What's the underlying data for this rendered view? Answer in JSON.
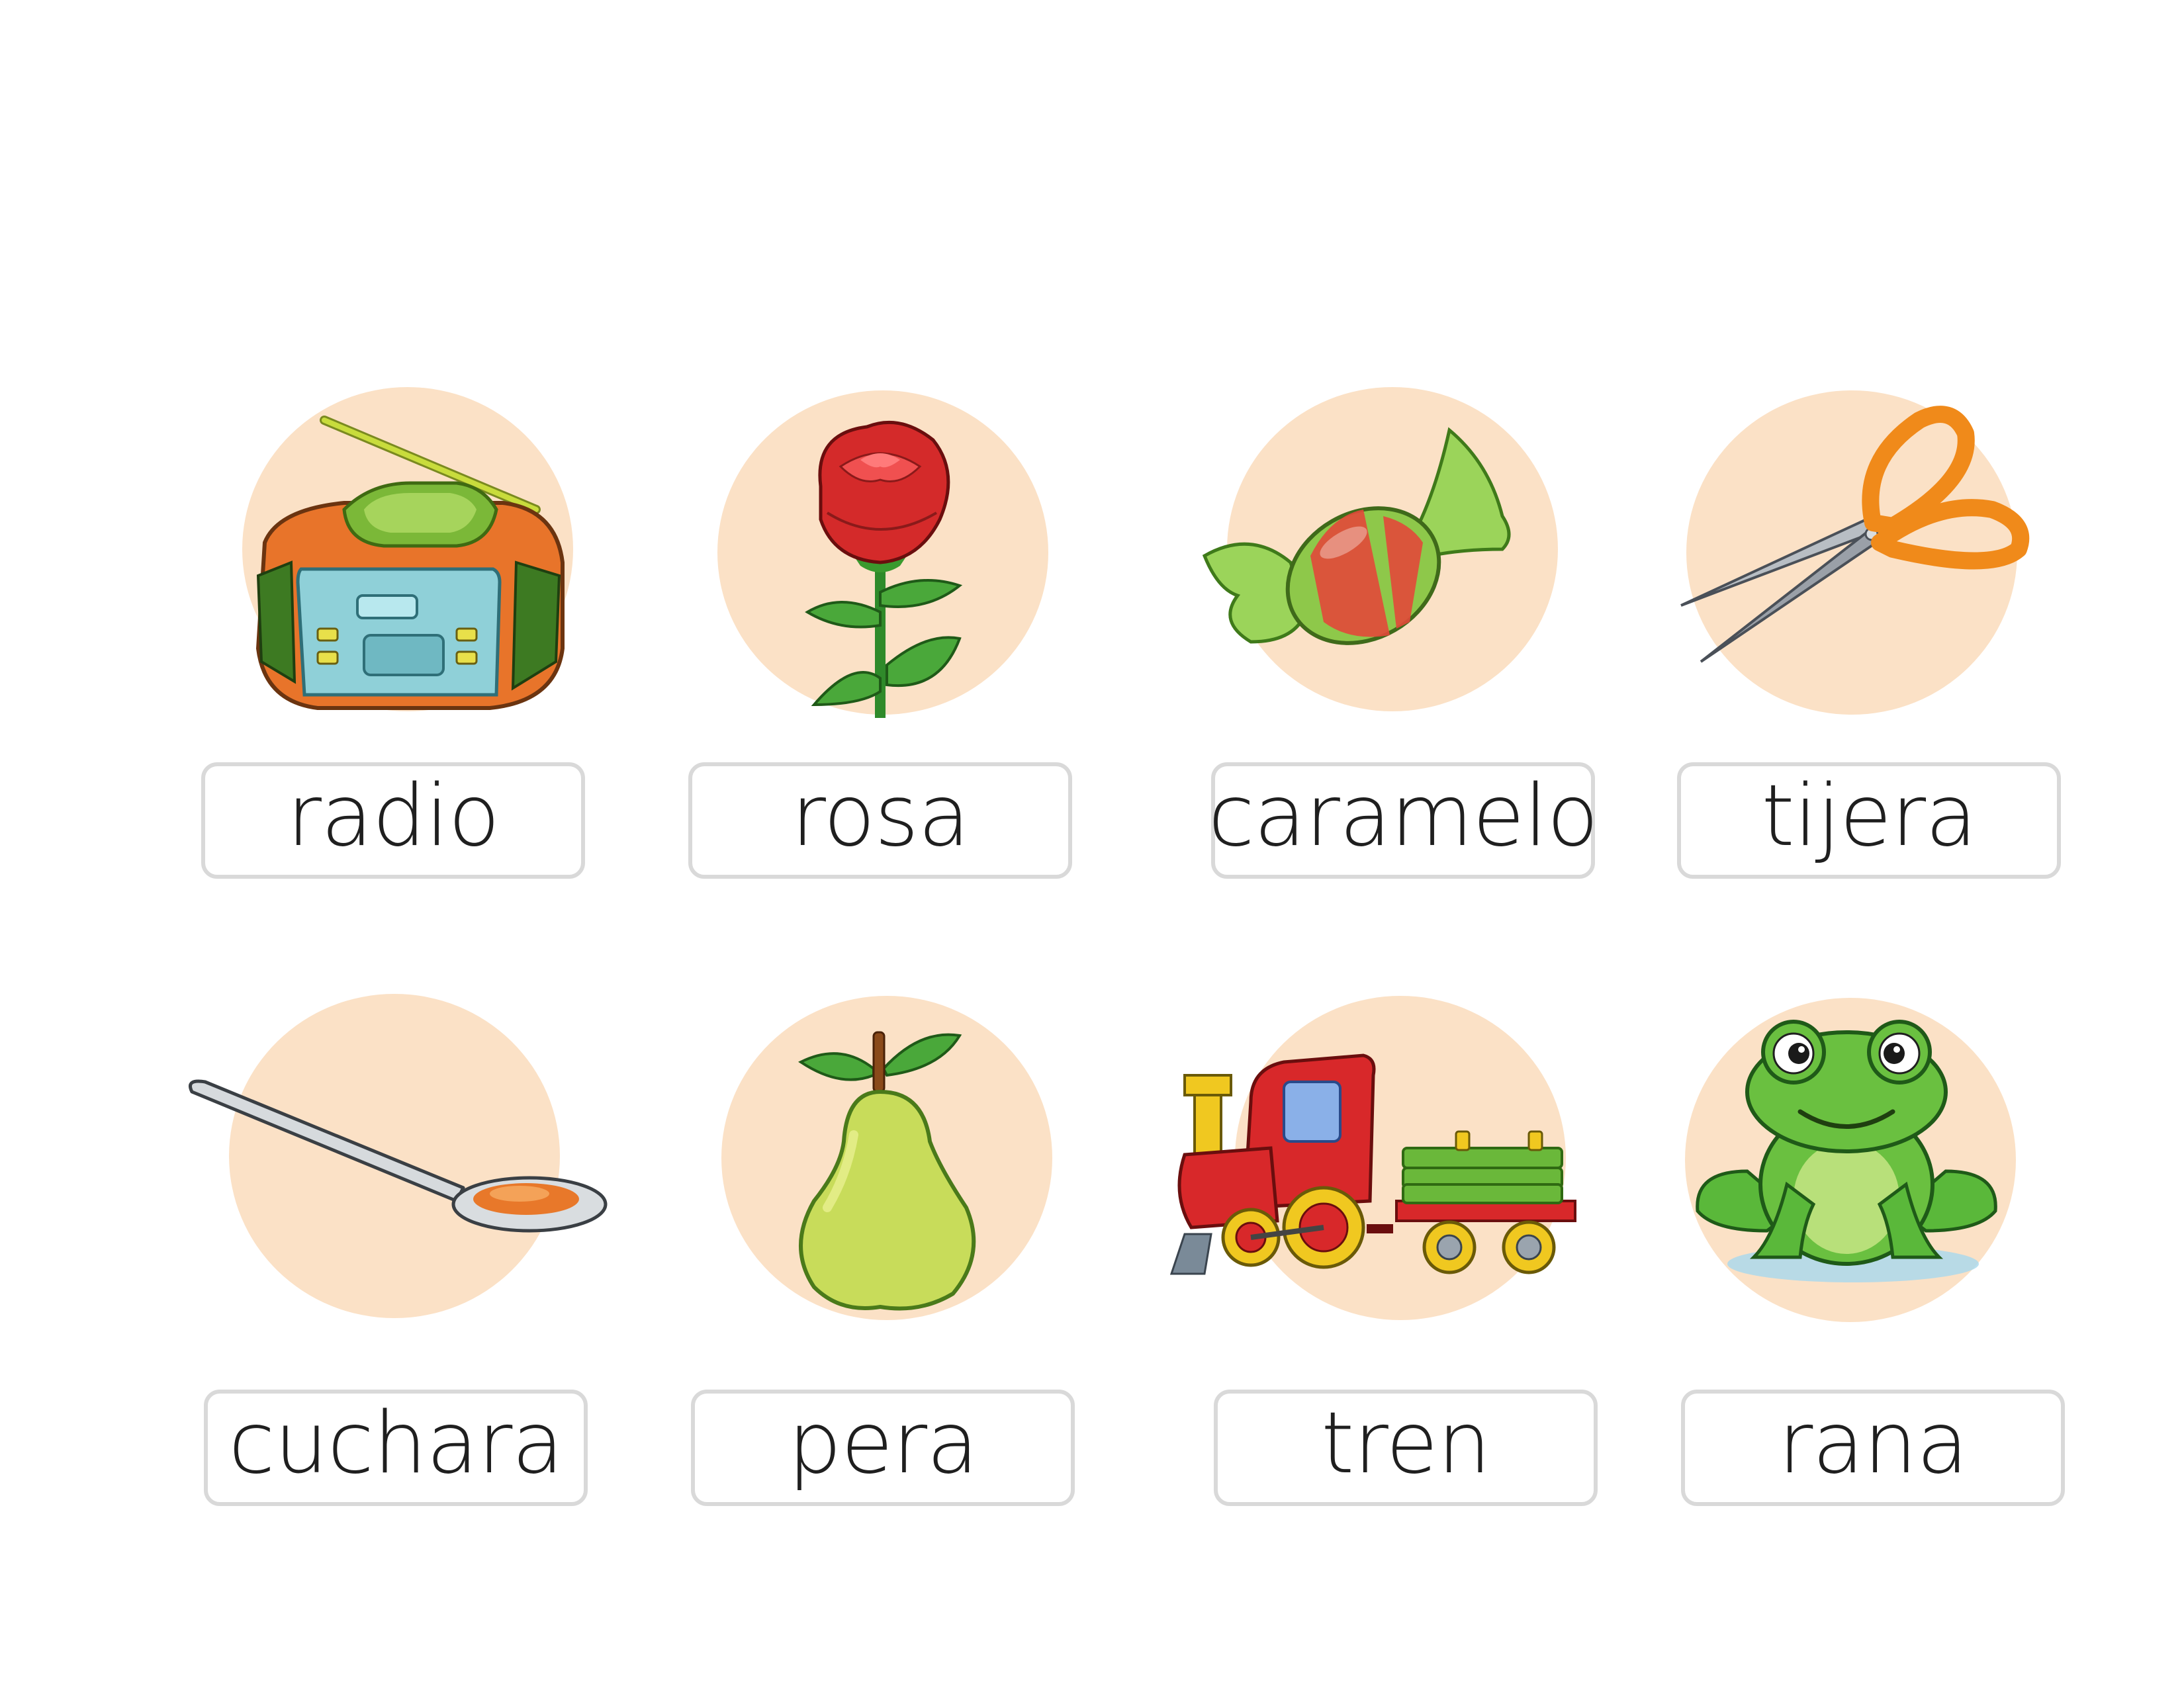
{
  "cards": [
    {
      "word": "radio",
      "icon": "radio-icon"
    },
    {
      "word": "rosa",
      "icon": "rose-icon"
    },
    {
      "word": "caramelo",
      "icon": "candy-icon"
    },
    {
      "word": "tijera",
      "icon": "scissors-icon"
    },
    {
      "word": "cuchara",
      "icon": "spoon-icon"
    },
    {
      "word": "pera",
      "icon": "pear-icon"
    },
    {
      "word": "tren",
      "icon": "train-icon"
    },
    {
      "word": "rana",
      "icon": "frog-icon"
    }
  ],
  "colors": {
    "circle": "#fbe1c6",
    "box_border": "#d9d9d9",
    "text": "#1f1f1f"
  }
}
